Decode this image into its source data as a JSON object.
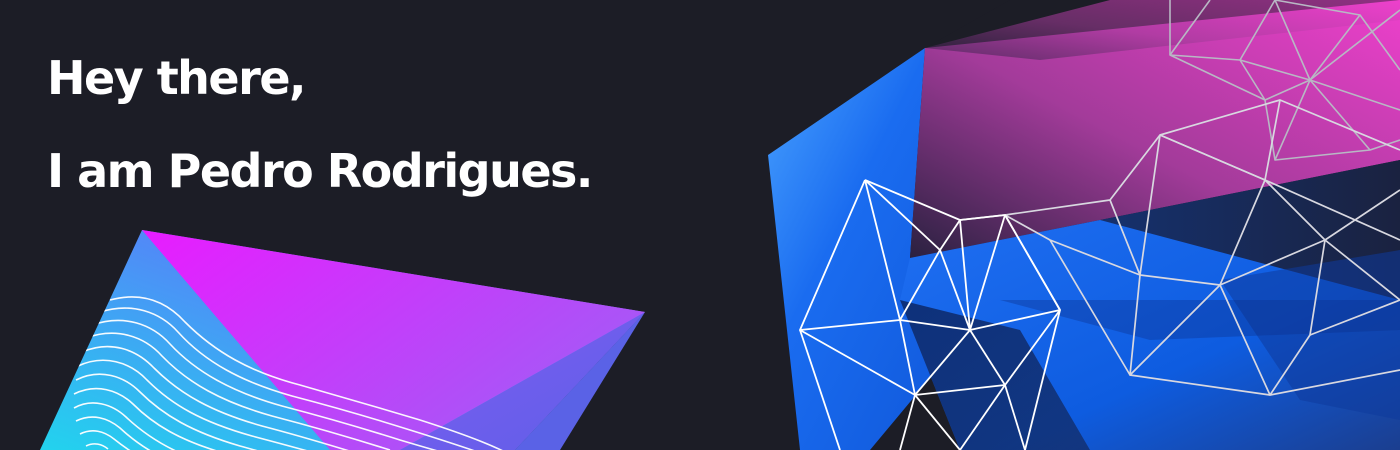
{
  "greeting": {
    "line1": "Hey there,",
    "line2": "I am Pedro Rodrigues."
  },
  "colors": {
    "background": "#1c1d26",
    "text": "#ffffff",
    "magenta": "#e81cff",
    "violet": "#8b5cf6",
    "cyan": "#22d3ee",
    "blue": "#1a6cf0",
    "pink": "#e040c8",
    "wireframe": "#d9d9e0"
  },
  "icons": {
    "left_shape": "abstract-gradient-crystal",
    "right_shape": "wireframe-polygon-mesh"
  }
}
